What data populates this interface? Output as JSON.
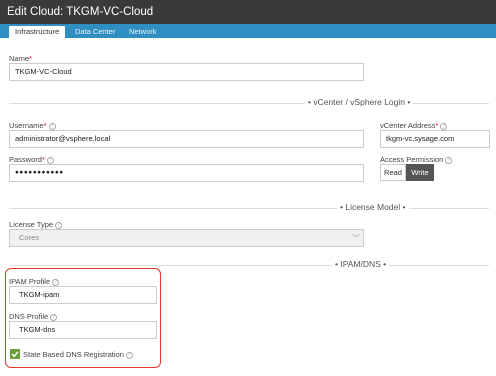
{
  "window": {
    "title": "Edit Cloud: TKGM-VC-Cloud"
  },
  "tabs": [
    {
      "label": "Infrastructure"
    },
    {
      "label": "Data Center"
    },
    {
      "label": "Network"
    }
  ],
  "fields": {
    "name": {
      "label": "Name",
      "value": "TKGM-VC-Cloud"
    },
    "username": {
      "label": "Username",
      "value": "administrator@vsphere.local"
    },
    "vcenter_address": {
      "label": "vCenter Address",
      "value": "tkgm-vc.sysage.com"
    },
    "password": {
      "label": "Password",
      "value": "●●●●●●●●●●●"
    },
    "access_permission": {
      "label": "Access Permission",
      "options": [
        "Read",
        "Write"
      ],
      "selected": "Write"
    },
    "license_type": {
      "label": "License Type",
      "value": "Cores"
    },
    "ipam_profile": {
      "label": "IPAM Profile",
      "value": "TKGM-ipam"
    },
    "dns_profile": {
      "label": "DNS Profile",
      "value": "TKGM-dns"
    },
    "state_dns": {
      "label": "State Based DNS Registration",
      "checked": true
    }
  },
  "sections": {
    "vcenter": "• vCenter / vSphere Login •",
    "license": "• License Model •",
    "ipam": "• IPAM/DNS •"
  },
  "colors": {
    "titlebar": "#3a3a3a",
    "tabbar": "#2f8fc2",
    "required": "#d0021b",
    "highlight": "#e0392b",
    "checkbox": "#6a9e3a",
    "write_selected": "#555555"
  }
}
